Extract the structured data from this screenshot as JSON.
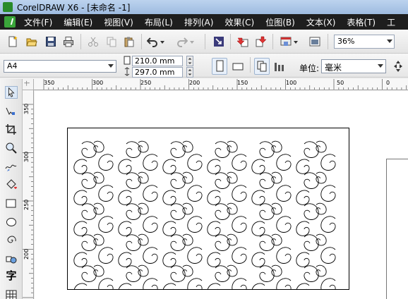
{
  "window": {
    "title": "CorelDRAW X6 - [未命名 -1]"
  },
  "menu": {
    "items": [
      "文件(F)",
      "编辑(E)",
      "视图(V)",
      "布局(L)",
      "排列(A)",
      "效果(C)",
      "位图(B)",
      "文本(X)",
      "表格(T)",
      "工"
    ]
  },
  "toolbar": {
    "zoom": "36%",
    "icons": [
      "new-icon",
      "open-icon",
      "save-icon",
      "print-icon",
      "cut-icon",
      "copy-icon",
      "paste-icon",
      "undo-icon",
      "redo-icon",
      "import-icon",
      "export-icon",
      "publish-icon",
      "app-launcher-icon",
      "welcome-icon"
    ]
  },
  "property_bar": {
    "page_size": "A4",
    "width": "210.0 mm",
    "height": "297.0 mm",
    "unit_label": "单位:",
    "unit_value": "毫米"
  },
  "rulers": {
    "horizontal": [
      "350",
      "300",
      "250",
      "200",
      "150",
      "100",
      "50",
      "0"
    ],
    "vertical": [
      "350",
      "300",
      "250",
      "200"
    ]
  },
  "toolbox": {
    "text_tool_label": "字",
    "tools": [
      "pick-tool-icon",
      "shape-tool-icon",
      "crop-tool-icon",
      "zoom-tool-icon",
      "freehand-tool-icon",
      "smart-fill-icon",
      "rectangle-tool-icon",
      "ellipse-tool-icon",
      "spiral-tool-icon",
      "basic-shapes-icon",
      "text-tool-icon",
      "table-tool-icon"
    ]
  }
}
